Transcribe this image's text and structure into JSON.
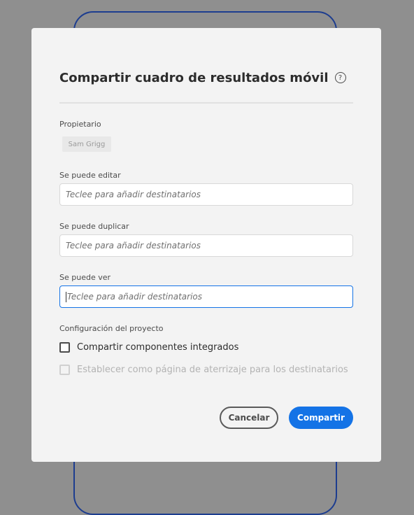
{
  "dialog": {
    "title": "Compartir cuadro de resultados móvil",
    "help_icon": "?"
  },
  "owner": {
    "label": "Propietario",
    "value": "Sam Grigg"
  },
  "fields": {
    "can_edit": {
      "label": "Se puede editar",
      "placeholder": "Teclee para añadir destinatarios"
    },
    "can_duplicate": {
      "label": "Se puede duplicar",
      "placeholder": "Teclee para añadir destinatarios"
    },
    "can_view": {
      "label": "Se puede ver",
      "placeholder": "Teclee para añadir destinatarios"
    }
  },
  "project_settings": {
    "label": "Configuración del proyecto",
    "share_components": {
      "label": "Compartir componentes integrados",
      "checked": false
    },
    "landing_page": {
      "label": "Establecer como página de aterrizaje para los destinatarios",
      "checked": false,
      "disabled": true
    }
  },
  "buttons": {
    "cancel": "Cancelar",
    "share": "Compartir"
  },
  "colors": {
    "accent": "#1473e6",
    "overlay": "#8f8f8f",
    "dialog_bg": "#f3f3f3"
  }
}
